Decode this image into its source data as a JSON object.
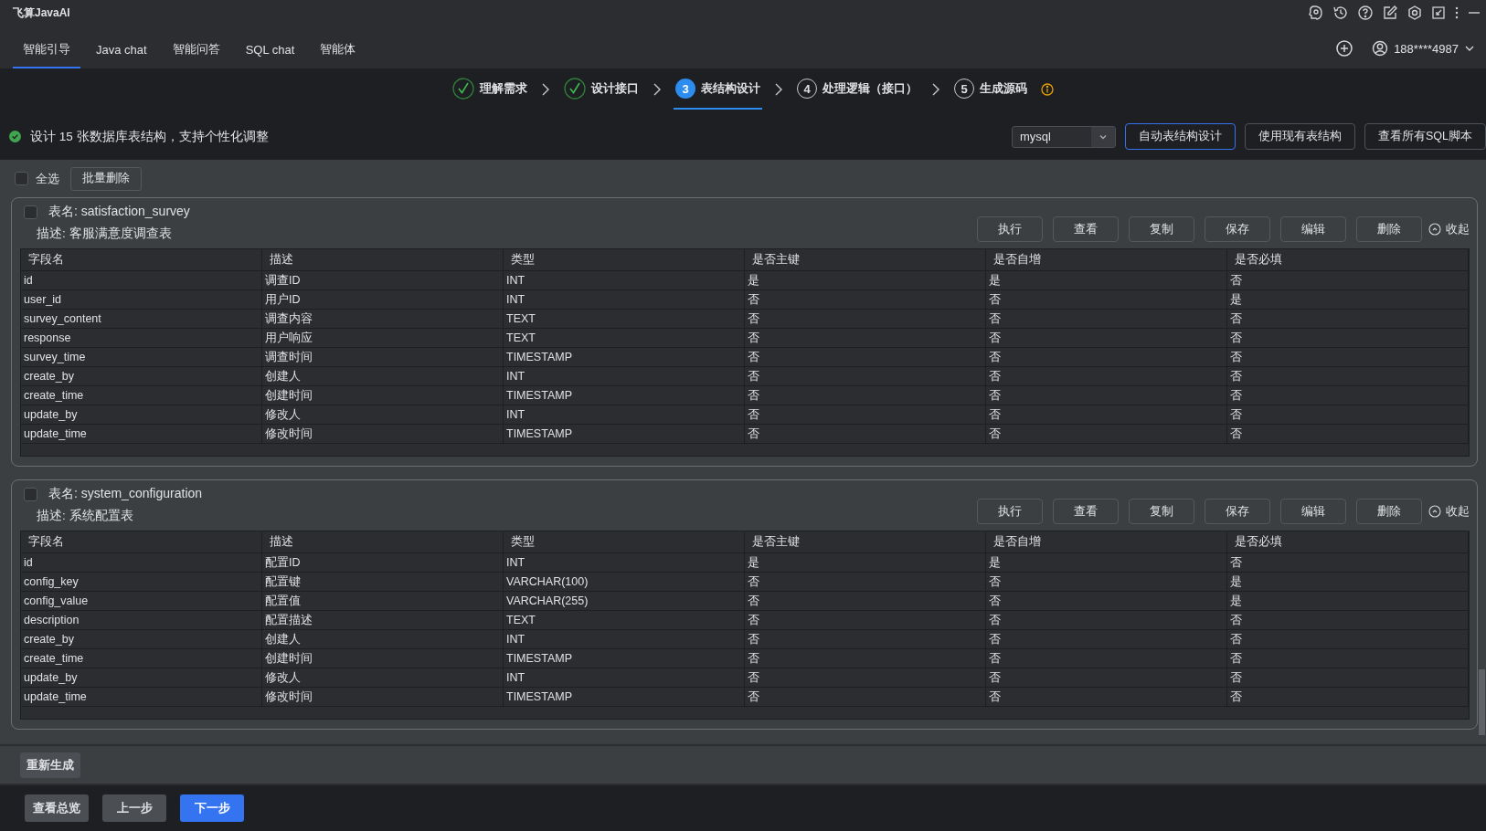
{
  "window": {
    "title": "飞算JavaAI"
  },
  "tabs": [
    {
      "label": "智能引导",
      "selected": true
    },
    {
      "label": "Java chat",
      "selected": false
    },
    {
      "label": "智能问答",
      "selected": false
    },
    {
      "label": "SQL chat",
      "selected": false
    },
    {
      "label": "智能体",
      "selected": false
    }
  ],
  "account": {
    "name": "188****4987"
  },
  "steps": [
    {
      "kind": "done",
      "label": "理解需求",
      "selected": false
    },
    {
      "kind": "done",
      "label": "设计接口",
      "selected": false
    },
    {
      "kind": "active",
      "number": "3",
      "label": "表结构设计",
      "selected": true
    },
    {
      "kind": "pending",
      "number": "4",
      "label": "处理逻辑（接口）",
      "selected": false
    },
    {
      "kind": "pending",
      "number": "5",
      "label": "生成源码",
      "selected": false
    }
  ],
  "info": {
    "message": "设计 15 张数据库表结构，支持个性化调整"
  },
  "db_select": {
    "value": "mysql"
  },
  "header_buttons": [
    {
      "label": "自动表结构设计",
      "selected": true
    },
    {
      "label": "使用现有表结构",
      "selected": false
    },
    {
      "label": "查看所有SQL脚本",
      "selected": false
    }
  ],
  "toolbar": {
    "select_all": {
      "label": "全选",
      "checked": false
    },
    "batch_delete": "批量删除"
  },
  "tables": [
    {
      "name": "表名: satisfaction_survey",
      "description": "描述: 客服满意度调查表",
      "checked": false,
      "actions": [
        "执行",
        "查看",
        "复制",
        "保存",
        "编辑",
        "删除"
      ],
      "collapse": "收起",
      "columns": [
        "字段名",
        "描述",
        "类型",
        "是否主键",
        "是否自增",
        "是否必填"
      ],
      "rows": [
        [
          "id",
          "调查ID",
          "INT",
          "是",
          "是",
          "否"
        ],
        [
          "user_id",
          "用户ID",
          "INT",
          "否",
          "否",
          "是"
        ],
        [
          "survey_content",
          "调查内容",
          "TEXT",
          "否",
          "否",
          "否"
        ],
        [
          "response",
          "用户响应",
          "TEXT",
          "否",
          "否",
          "否"
        ],
        [
          "survey_time",
          "调查时间",
          "TIMESTAMP",
          "否",
          "否",
          "否"
        ],
        [
          "create_by",
          "创建人",
          "INT",
          "否",
          "否",
          "否"
        ],
        [
          "create_time",
          "创建时间",
          "TIMESTAMP",
          "否",
          "否",
          "否"
        ],
        [
          "update_by",
          "修改人",
          "INT",
          "否",
          "否",
          "否"
        ],
        [
          "update_time",
          "修改时间",
          "TIMESTAMP",
          "否",
          "否",
          "否"
        ]
      ]
    },
    {
      "name": "表名: system_configuration",
      "description": "描述: 系统配置表",
      "checked": false,
      "actions": [
        "执行",
        "查看",
        "复制",
        "保存",
        "编辑",
        "删除"
      ],
      "collapse": "收起",
      "columns": [
        "字段名",
        "描述",
        "类型",
        "是否主键",
        "是否自增",
        "是否必填"
      ],
      "rows": [
        [
          "id",
          "配置ID",
          "INT",
          "是",
          "是",
          "否"
        ],
        [
          "config_key",
          "配置键",
          "VARCHAR(100)",
          "否",
          "否",
          "是"
        ],
        [
          "config_value",
          "配置值",
          "VARCHAR(255)",
          "否",
          "否",
          "是"
        ],
        [
          "description",
          "配置描述",
          "TEXT",
          "否",
          "否",
          "否"
        ],
        [
          "create_by",
          "创建人",
          "INT",
          "否",
          "否",
          "否"
        ],
        [
          "create_time",
          "创建时间",
          "TIMESTAMP",
          "否",
          "否",
          "否"
        ],
        [
          "update_by",
          "修改人",
          "INT",
          "否",
          "否",
          "否"
        ],
        [
          "update_time",
          "修改时间",
          "TIMESTAMP",
          "否",
          "否",
          "否"
        ]
      ]
    }
  ],
  "regenerate": "重新生成",
  "footer_buttons": [
    {
      "label": "查看总览",
      "kind": "secondary"
    },
    {
      "label": "上一步",
      "kind": "secondary"
    },
    {
      "label": "下一步",
      "kind": "primary"
    }
  ]
}
